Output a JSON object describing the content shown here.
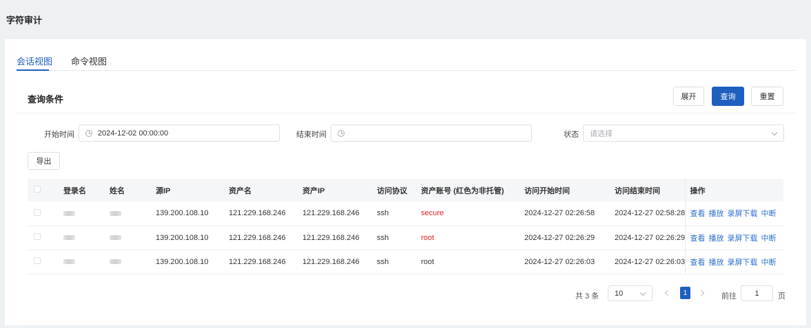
{
  "page": {
    "title": "字符审计"
  },
  "tabs": [
    {
      "label": "会话视图",
      "active": true
    },
    {
      "label": "命令视图",
      "active": false
    }
  ],
  "query": {
    "title": "查询条件",
    "expand_label": "展开",
    "search_label": "查询",
    "reset_label": "重置",
    "start_label": "开始时间",
    "start_value": "2024-12-02 00:00:00",
    "end_label": "结束时间",
    "end_value": "",
    "status_label": "状态",
    "status_placeholder": "请选择",
    "export_label": "导出"
  },
  "table": {
    "columns": [
      "",
      "登录名",
      "姓名",
      "源IP",
      "资产名",
      "资产IP",
      "访问协议",
      "资产账号 (红色为非托管)",
      "访问开始时间",
      "访问结束时间",
      "操作"
    ],
    "actions": [
      "查看",
      "播放",
      "录屏下载",
      "中断"
    ],
    "rows": [
      {
        "src_ip": "139.200.108.10",
        "asset_name": "121.229.168.246",
        "asset_ip": "121.229.168.246",
        "protocol": "ssh",
        "account": "secure",
        "account_unmanaged": true,
        "start": "2024-12-27 02:26:58",
        "end": "2024-12-27 02:58:28"
      },
      {
        "src_ip": "139.200.108.10",
        "asset_name": "121.229.168.246",
        "asset_ip": "121.229.168.246",
        "protocol": "ssh",
        "account": "root",
        "account_unmanaged": true,
        "start": "2024-12-27 02:26:29",
        "end": "2024-12-27 02:26:29"
      },
      {
        "src_ip": "139.200.108.10",
        "asset_name": "121.229.168.246",
        "asset_ip": "121.229.168.246",
        "protocol": "ssh",
        "account": "root",
        "account_unmanaged": false,
        "start": "2024-12-27 02:26:03",
        "end": "2024-12-27 02:26:03"
      }
    ]
  },
  "pagination": {
    "total_text": "共 3 条",
    "page_size": "10",
    "current_page": "1",
    "goto_label": "前往",
    "goto_value": "1",
    "page_suffix": "页"
  },
  "colors": {
    "primary": "#1f5fbf",
    "link": "#2f6fd0",
    "unmanaged": "#e02020"
  }
}
